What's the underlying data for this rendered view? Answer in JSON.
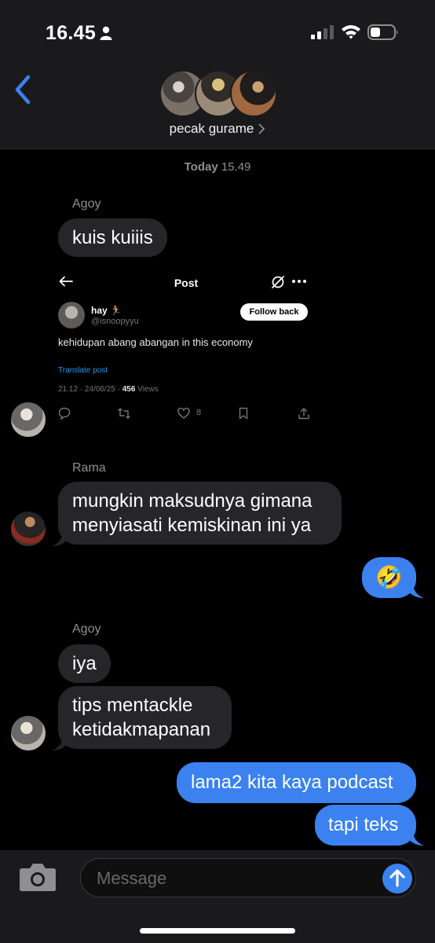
{
  "status_bar": {
    "time": "16.45",
    "icons": [
      "person-icon",
      "signal-icon",
      "wifi-icon",
      "battery-icon"
    ]
  },
  "header": {
    "group_name": "pecak gurame",
    "back_icon": "chevron-left-icon"
  },
  "chat": {
    "timestamp_day": "Today",
    "timestamp_time": "15.49",
    "messages": [
      {
        "sender": "Agoy",
        "text": "kuis kuiiis"
      },
      {
        "sender": "Rama",
        "text_line1": "mungkin maksudnya gimana",
        "text_line2": "menyiasati kemiskinan ini ya"
      },
      {
        "sender": "me",
        "text": "🤣"
      },
      {
        "sender": "Agoy",
        "text": "iya"
      },
      {
        "sender": "Agoy",
        "text_line1": "tips mentackle",
        "text_line2": "ketidakmapanan"
      },
      {
        "sender": "me",
        "text": "lama2 kita kaya podcast"
      },
      {
        "sender": "me",
        "text": "tapi teks"
      }
    ]
  },
  "tweet": {
    "title": "Post",
    "name": "hay 🏃",
    "handle": "@isnoopyyu",
    "follow_label": "Follow back",
    "text": "kehidupan abang abangan in this economy",
    "translate": "Translate post",
    "time": "21.12 · 24/06/25 · ",
    "views_count": "456",
    "views_label": " Views",
    "like_count": "8"
  },
  "composer": {
    "placeholder": "Message"
  },
  "colors": {
    "accent": "#3b82f0",
    "incoming_bubble": "#262628",
    "background": "#000000"
  }
}
